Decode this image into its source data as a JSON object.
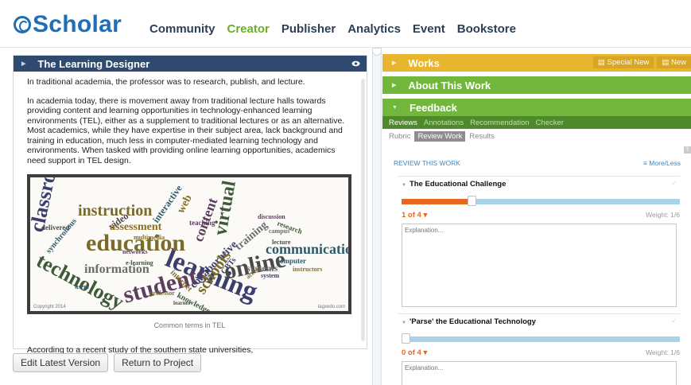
{
  "logo": {
    "text": "Scholar"
  },
  "nav": [
    {
      "label": "Community",
      "active": false
    },
    {
      "label": "Creator",
      "active": true
    },
    {
      "label": "Publisher",
      "active": false
    },
    {
      "label": "Analytics",
      "active": false
    },
    {
      "label": "Event",
      "active": false
    },
    {
      "label": "Bookstore",
      "active": false
    }
  ],
  "document": {
    "title": "The Learning Designer",
    "paragraphs": [
      "In traditional academia, the professor was to research, publish, and lecture.",
      "In academia today, there is movement away from traditional lecture halls towards providing content and learning opportunities in technology-enhanced learning environments (TEL), either as a supplement to traditional lectures or as an alternative. Most academics, while they have expertise in their subject area, lack background and training in education, much less in computer-mediated learning technology and environments. When tasked with providing online learning opportunities, academics need support in TEL design."
    ],
    "figure": {
      "caption": "Common terms in TEL",
      "copyright": "Copyright 2014",
      "source": "tagxedo.com",
      "words": [
        "classroom",
        "instruction",
        "video",
        "interactive",
        "web",
        "content",
        "virtual",
        "training",
        "learning",
        "education",
        "online",
        "communication",
        "assessment",
        "students",
        "technology",
        "information",
        "collaborative",
        "schools",
        "delivered",
        "synchronous",
        "internet",
        "networks",
        "knowledge",
        "systems",
        "CBTs",
        "access",
        "lecture",
        "computer",
        "multimedia",
        "teaching",
        "research",
        "campus",
        "system",
        "professor",
        "learner",
        "users",
        "instructors",
        "discussion",
        "e-learning"
      ]
    },
    "last_paragraph": "According to a recent study of the southern state universities,"
  },
  "actions": {
    "edit": "Edit Latest Version",
    "return": "Return to Project"
  },
  "right_panel": {
    "works_title": "Works",
    "special_new": "Special New",
    "new": "New",
    "about_title": "About This Work",
    "feedback_title": "Feedback",
    "tabs": [
      "Reviews",
      "Annotations",
      "Recommendation",
      "Checker"
    ],
    "active_tab": "Reviews",
    "subtabs": [
      "Rubric",
      "Review Work",
      "Results"
    ],
    "active_subtab": "Review Work",
    "help": "?",
    "review_label": "REVIEW THIS WORK",
    "more_less": "≡ More/Less",
    "criteria": [
      {
        "title": "The Educational Challenge",
        "score": "1 of 4 ▾",
        "weight": "Weight: 1/6",
        "placeholder": "Explanation...",
        "level": 0.25
      },
      {
        "title": "'Parse' the Educational Technology",
        "score": "0 of 4 ▾",
        "weight": "Weight: 1/6",
        "placeholder": "Explanation...",
        "level": 0
      }
    ]
  },
  "colors": {
    "brand": "#1f6fb6",
    "active_nav": "#6aae2c",
    "works": "#e7b52e",
    "feedback": "#72b73c",
    "title_bar": "#2e4a6e",
    "score": "#e9681f",
    "track": "#a8d3e9"
  }
}
